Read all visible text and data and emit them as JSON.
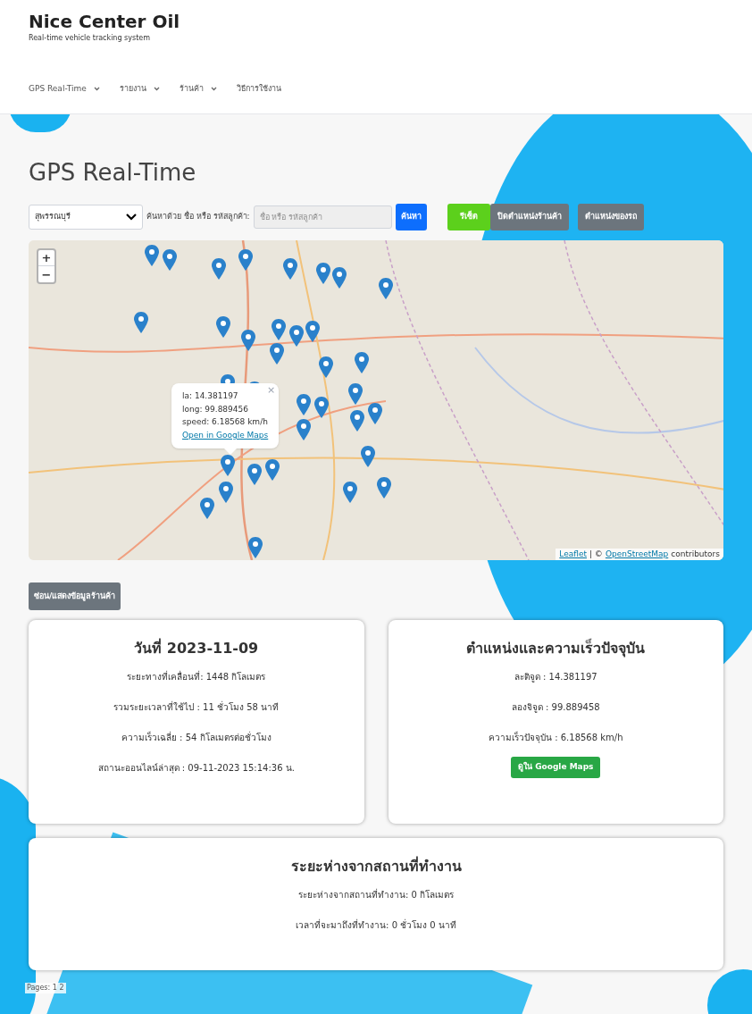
{
  "brand": {
    "title": "Nice Center Oil",
    "subtitle": "Real-time vehicle tracking system"
  },
  "nav": [
    {
      "label": "GPS Real-Time",
      "dropdown": true
    },
    {
      "label": "รายงาน",
      "dropdown": true
    },
    {
      "label": "ร้านค้า",
      "dropdown": true
    },
    {
      "label": "วิธีการใช้งาน",
      "dropdown": false
    }
  ],
  "page_title": "GPS Real-Time",
  "toolbar": {
    "province": "สุพรรณบุรี",
    "search_label": "ค้นหาด้วย ชื่อ หรือ รหัสลูกค้า:",
    "search_placeholder": "ชื่อ หรือ รหัสลูกค้า",
    "buttons": [
      {
        "label": "ค้นหา",
        "kind": "primary"
      },
      {
        "label": "รีเซ็ต",
        "kind": "success"
      },
      {
        "label": "ปิดตำแหน่งร้านค้า",
        "kind": "secondary"
      },
      {
        "label": "ตำแหน่งของรถ",
        "kind": "secondary"
      }
    ]
  },
  "map": {
    "zoom_in": "+",
    "zoom_out": "−",
    "popup": {
      "close": "×",
      "lines": [
        "la: 14.381197",
        "long: 99.889456",
        "speed: 6.18568 km/h"
      ],
      "link": "Open in Google Maps"
    },
    "attribution": {
      "leaflet": "Leaflet",
      "separator": "| ©",
      "osm": "OpenStreetMap",
      "suffix": "contributors"
    }
  },
  "toggle_button": "ซ่อน/แสดงข้อมูลร้านค้า",
  "cards": [
    {
      "title": "วันที่ 2023-11-09",
      "lines": [
        "ระยะทางที่เคลื่อนที่: 1448 กิโลเมตร",
        "รวมระยะเวลาที่ใช้ไป : 11 ชั่วโมง 58 นาที",
        "ความเร็วเฉลี่ย : 54 กิโลเมตรต่อชั่วโมง",
        "สถานะออนไลน์ล่าสุด : 09-11-2023 15:14:36 น."
      ]
    },
    {
      "title": "ตำแหน่งและความเร็วปัจจุบัน",
      "lines": [
        "ละติจูด : 14.381197",
        "ลองจิจูด : 99.889458",
        "ความเร็วปัจจุบัน : 6.18568 km/h"
      ],
      "button": "ดูใน Google Maps"
    },
    {
      "title": "ระยะห่างจากสถานที่ทำงาน",
      "lines": [
        "ระยะห่างจากสถานที่ทำงาน: 0 กิโลเมตร",
        "เวลาที่จะมาถึงที่ทำงาน: 0 ชั่วโมง 0 นาที"
      ]
    }
  ],
  "footer": "Pages: 1 2"
}
